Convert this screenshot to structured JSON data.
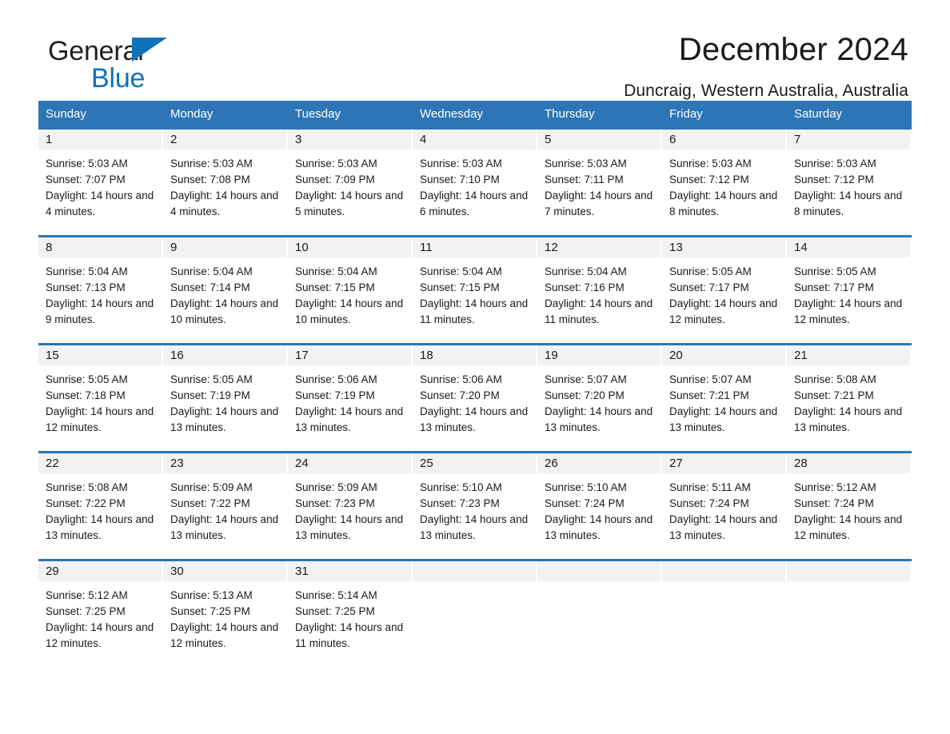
{
  "brand": {
    "word1": "General",
    "word2": "Blue",
    "triangle_color": "#1072ba",
    "text_color": "#231f20"
  },
  "header": {
    "title": "December 2024",
    "subtitle": "Duncraig, Western Australia, Australia"
  },
  "theme": {
    "header_bg": "#2e75b6",
    "header_text": "#ffffff",
    "datebar_bg": "#f2f2f2",
    "rule_color": "#2e75b6",
    "body_text": "#1a1a1a"
  },
  "weekdays": [
    "Sunday",
    "Monday",
    "Tuesday",
    "Wednesday",
    "Thursday",
    "Friday",
    "Saturday"
  ],
  "weeks": [
    [
      {
        "day": "1",
        "sunrise": "Sunrise: 5:03 AM",
        "sunset": "Sunset: 7:07 PM",
        "daylight": "Daylight: 14 hours and 4 minutes."
      },
      {
        "day": "2",
        "sunrise": "Sunrise: 5:03 AM",
        "sunset": "Sunset: 7:08 PM",
        "daylight": "Daylight: 14 hours and 4 minutes."
      },
      {
        "day": "3",
        "sunrise": "Sunrise: 5:03 AM",
        "sunset": "Sunset: 7:09 PM",
        "daylight": "Daylight: 14 hours and 5 minutes."
      },
      {
        "day": "4",
        "sunrise": "Sunrise: 5:03 AM",
        "sunset": "Sunset: 7:10 PM",
        "daylight": "Daylight: 14 hours and 6 minutes."
      },
      {
        "day": "5",
        "sunrise": "Sunrise: 5:03 AM",
        "sunset": "Sunset: 7:11 PM",
        "daylight": "Daylight: 14 hours and 7 minutes."
      },
      {
        "day": "6",
        "sunrise": "Sunrise: 5:03 AM",
        "sunset": "Sunset: 7:12 PM",
        "daylight": "Daylight: 14 hours and 8 minutes."
      },
      {
        "day": "7",
        "sunrise": "Sunrise: 5:03 AM",
        "sunset": "Sunset: 7:12 PM",
        "daylight": "Daylight: 14 hours and 8 minutes."
      }
    ],
    [
      {
        "day": "8",
        "sunrise": "Sunrise: 5:04 AM",
        "sunset": "Sunset: 7:13 PM",
        "daylight": "Daylight: 14 hours and 9 minutes."
      },
      {
        "day": "9",
        "sunrise": "Sunrise: 5:04 AM",
        "sunset": "Sunset: 7:14 PM",
        "daylight": "Daylight: 14 hours and 10 minutes."
      },
      {
        "day": "10",
        "sunrise": "Sunrise: 5:04 AM",
        "sunset": "Sunset: 7:15 PM",
        "daylight": "Daylight: 14 hours and 10 minutes."
      },
      {
        "day": "11",
        "sunrise": "Sunrise: 5:04 AM",
        "sunset": "Sunset: 7:15 PM",
        "daylight": "Daylight: 14 hours and 11 minutes."
      },
      {
        "day": "12",
        "sunrise": "Sunrise: 5:04 AM",
        "sunset": "Sunset: 7:16 PM",
        "daylight": "Daylight: 14 hours and 11 minutes."
      },
      {
        "day": "13",
        "sunrise": "Sunrise: 5:05 AM",
        "sunset": "Sunset: 7:17 PM",
        "daylight": "Daylight: 14 hours and 12 minutes."
      },
      {
        "day": "14",
        "sunrise": "Sunrise: 5:05 AM",
        "sunset": "Sunset: 7:17 PM",
        "daylight": "Daylight: 14 hours and 12 minutes."
      }
    ],
    [
      {
        "day": "15",
        "sunrise": "Sunrise: 5:05 AM",
        "sunset": "Sunset: 7:18 PM",
        "daylight": "Daylight: 14 hours and 12 minutes."
      },
      {
        "day": "16",
        "sunrise": "Sunrise: 5:05 AM",
        "sunset": "Sunset: 7:19 PM",
        "daylight": "Daylight: 14 hours and 13 minutes."
      },
      {
        "day": "17",
        "sunrise": "Sunrise: 5:06 AM",
        "sunset": "Sunset: 7:19 PM",
        "daylight": "Daylight: 14 hours and 13 minutes."
      },
      {
        "day": "18",
        "sunrise": "Sunrise: 5:06 AM",
        "sunset": "Sunset: 7:20 PM",
        "daylight": "Daylight: 14 hours and 13 minutes."
      },
      {
        "day": "19",
        "sunrise": "Sunrise: 5:07 AM",
        "sunset": "Sunset: 7:20 PM",
        "daylight": "Daylight: 14 hours and 13 minutes."
      },
      {
        "day": "20",
        "sunrise": "Sunrise: 5:07 AM",
        "sunset": "Sunset: 7:21 PM",
        "daylight": "Daylight: 14 hours and 13 minutes."
      },
      {
        "day": "21",
        "sunrise": "Sunrise: 5:08 AM",
        "sunset": "Sunset: 7:21 PM",
        "daylight": "Daylight: 14 hours and 13 minutes."
      }
    ],
    [
      {
        "day": "22",
        "sunrise": "Sunrise: 5:08 AM",
        "sunset": "Sunset: 7:22 PM",
        "daylight": "Daylight: 14 hours and 13 minutes."
      },
      {
        "day": "23",
        "sunrise": "Sunrise: 5:09 AM",
        "sunset": "Sunset: 7:22 PM",
        "daylight": "Daylight: 14 hours and 13 minutes."
      },
      {
        "day": "24",
        "sunrise": "Sunrise: 5:09 AM",
        "sunset": "Sunset: 7:23 PM",
        "daylight": "Daylight: 14 hours and 13 minutes."
      },
      {
        "day": "25",
        "sunrise": "Sunrise: 5:10 AM",
        "sunset": "Sunset: 7:23 PM",
        "daylight": "Daylight: 14 hours and 13 minutes."
      },
      {
        "day": "26",
        "sunrise": "Sunrise: 5:10 AM",
        "sunset": "Sunset: 7:24 PM",
        "daylight": "Daylight: 14 hours and 13 minutes."
      },
      {
        "day": "27",
        "sunrise": "Sunrise: 5:11 AM",
        "sunset": "Sunset: 7:24 PM",
        "daylight": "Daylight: 14 hours and 13 minutes."
      },
      {
        "day": "28",
        "sunrise": "Sunrise: 5:12 AM",
        "sunset": "Sunset: 7:24 PM",
        "daylight": "Daylight: 14 hours and 12 minutes."
      }
    ],
    [
      {
        "day": "29",
        "sunrise": "Sunrise: 5:12 AM",
        "sunset": "Sunset: 7:25 PM",
        "daylight": "Daylight: 14 hours and 12 minutes."
      },
      {
        "day": "30",
        "sunrise": "Sunrise: 5:13 AM",
        "sunset": "Sunset: 7:25 PM",
        "daylight": "Daylight: 14 hours and 12 minutes."
      },
      {
        "day": "31",
        "sunrise": "Sunrise: 5:14 AM",
        "sunset": "Sunset: 7:25 PM",
        "daylight": "Daylight: 14 hours and 11 minutes."
      },
      {
        "day": "",
        "sunrise": "",
        "sunset": "",
        "daylight": ""
      },
      {
        "day": "",
        "sunrise": "",
        "sunset": "",
        "daylight": ""
      },
      {
        "day": "",
        "sunrise": "",
        "sunset": "",
        "daylight": ""
      },
      {
        "day": "",
        "sunrise": "",
        "sunset": "",
        "daylight": ""
      }
    ]
  ]
}
